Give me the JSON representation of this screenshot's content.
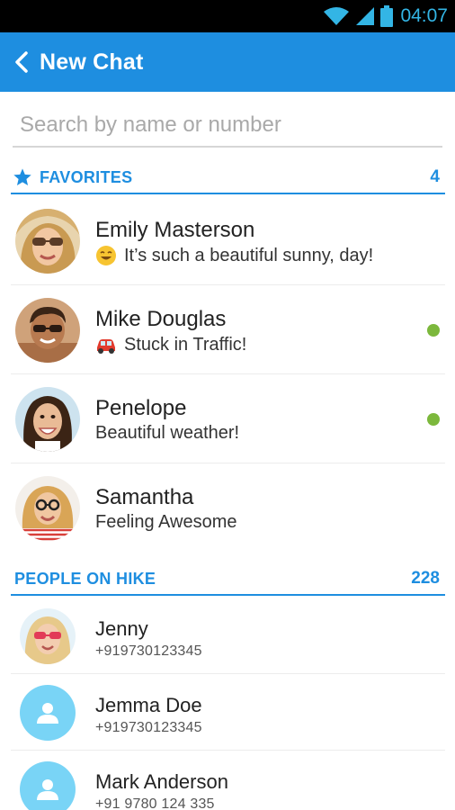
{
  "status_bar": {
    "time": "04:07",
    "icons": [
      "wifi-icon",
      "signal-icon",
      "battery-icon"
    ]
  },
  "header": {
    "title": "New Chat",
    "back_icon": "chevron-left-icon"
  },
  "search": {
    "placeholder": "Search by name or number",
    "value": ""
  },
  "favorites": {
    "title": "FAVORITES",
    "count": "4",
    "items": [
      {
        "name": "Emily Masterson",
        "status": "It’s such a beautiful sunny, day!",
        "status_icon": "smile-emoji-icon",
        "online": false
      },
      {
        "name": "Mike Douglas",
        "status": "Stuck in Traffic!",
        "status_icon": "car-emoji-icon",
        "online": true
      },
      {
        "name": "Penelope",
        "status": "Beautiful weather!",
        "online": true
      },
      {
        "name": "Samantha",
        "status": "Feeling Awesome",
        "online": false
      }
    ]
  },
  "people_on_hike": {
    "title": "PEOPLE ON HIKE",
    "count": "228",
    "items": [
      {
        "name": "Jenny",
        "phone": "+919730123345",
        "avatar": "photo"
      },
      {
        "name": "Jemma Doe",
        "phone": "+919730123345",
        "avatar": "default-user-icon"
      },
      {
        "name": "Mark Anderson",
        "phone": "+91 9780 124 335",
        "avatar": "default-user-icon"
      }
    ]
  },
  "colors": {
    "primary": "#1e8ee0",
    "online": "#7cb83c",
    "status_time": "#33b5e5",
    "default_avatar": "#79d4f6"
  }
}
